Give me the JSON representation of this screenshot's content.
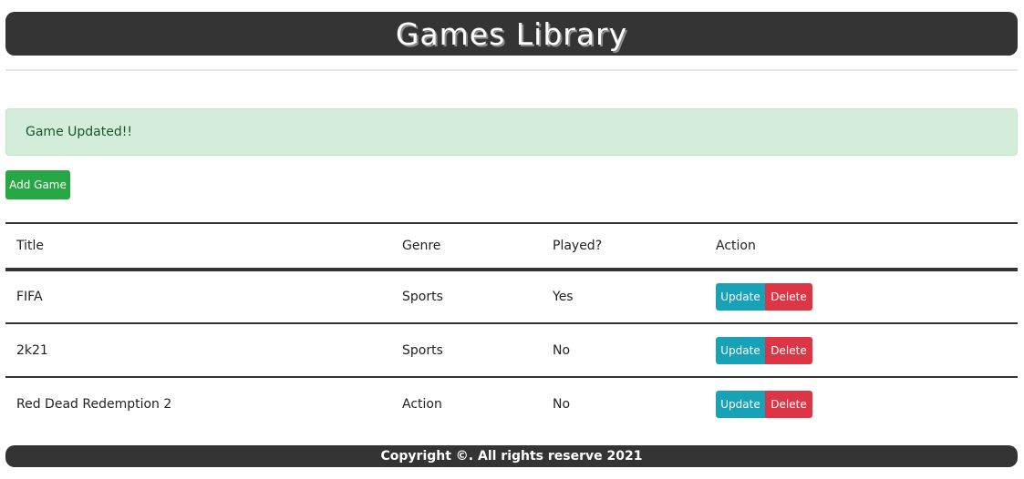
{
  "header": {
    "title": "Games Library"
  },
  "alert": {
    "message": "Game Updated!!"
  },
  "actions": {
    "add_label": "Add Game"
  },
  "table": {
    "columns": [
      "Title",
      "Genre",
      "Played?",
      "Action"
    ],
    "rows": [
      {
        "title": "FIFA",
        "genre": "Sports",
        "played": "Yes",
        "update": "Update",
        "delete": "Delete"
      },
      {
        "title": "2k21",
        "genre": "Sports",
        "played": "No",
        "update": "Update",
        "delete": "Delete"
      },
      {
        "title": "Red Dead Redemption 2",
        "genre": "Action",
        "played": "No",
        "update": "Update",
        "delete": "Delete"
      }
    ]
  },
  "footer": {
    "text": "Copyright ©. All rights reserve 2021"
  },
  "colors": {
    "header_bg": "#343434",
    "alert_bg": "#d4edda",
    "alert_text": "#155724",
    "add_button": "#28a745",
    "update_button": "#17a2b8",
    "delete_button": "#dc3545"
  }
}
